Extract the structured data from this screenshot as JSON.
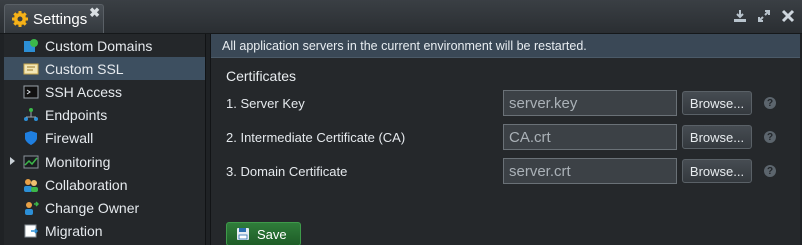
{
  "window": {
    "tab_title": "Settings",
    "tab_close": "✖",
    "controls": [
      "download-icon",
      "expand-icon",
      "close-icon"
    ]
  },
  "sidebar": {
    "items": [
      {
        "label": "Custom Domains",
        "icon": "globe-icon",
        "active": false
      },
      {
        "label": "Custom SSL",
        "icon": "certificate-icon",
        "active": true
      },
      {
        "label": "SSH Access",
        "icon": "terminal-icon",
        "active": false
      },
      {
        "label": "Endpoints",
        "icon": "endpoints-icon",
        "active": false
      },
      {
        "label": "Firewall",
        "icon": "shield-icon",
        "active": false
      },
      {
        "label": "Monitoring",
        "icon": "chart-icon",
        "active": false,
        "expandable": true
      },
      {
        "label": "Collaboration",
        "icon": "users-icon",
        "active": false
      },
      {
        "label": "Change Owner",
        "icon": "user-swap-icon",
        "active": false
      },
      {
        "label": "Migration",
        "icon": "migration-icon",
        "active": false
      }
    ]
  },
  "main": {
    "banner": "All application servers in the current environment will be restarted.",
    "section_title": "Certificates",
    "rows": [
      {
        "label": "1. Server Key",
        "value": "server.key",
        "browse": "Browse...",
        "help": "?"
      },
      {
        "label": "2. Intermediate Certificate (CA)",
        "value": "CA.crt",
        "browse": "Browse...",
        "help": "?"
      },
      {
        "label": "3. Domain Certificate",
        "value": "server.crt",
        "browse": "Browse...",
        "help": "?"
      }
    ],
    "save_label": "Save"
  },
  "colors": {
    "active_item": "#3d4f60",
    "banner_bg": "#3a4856",
    "save_button": "#2a7334"
  }
}
